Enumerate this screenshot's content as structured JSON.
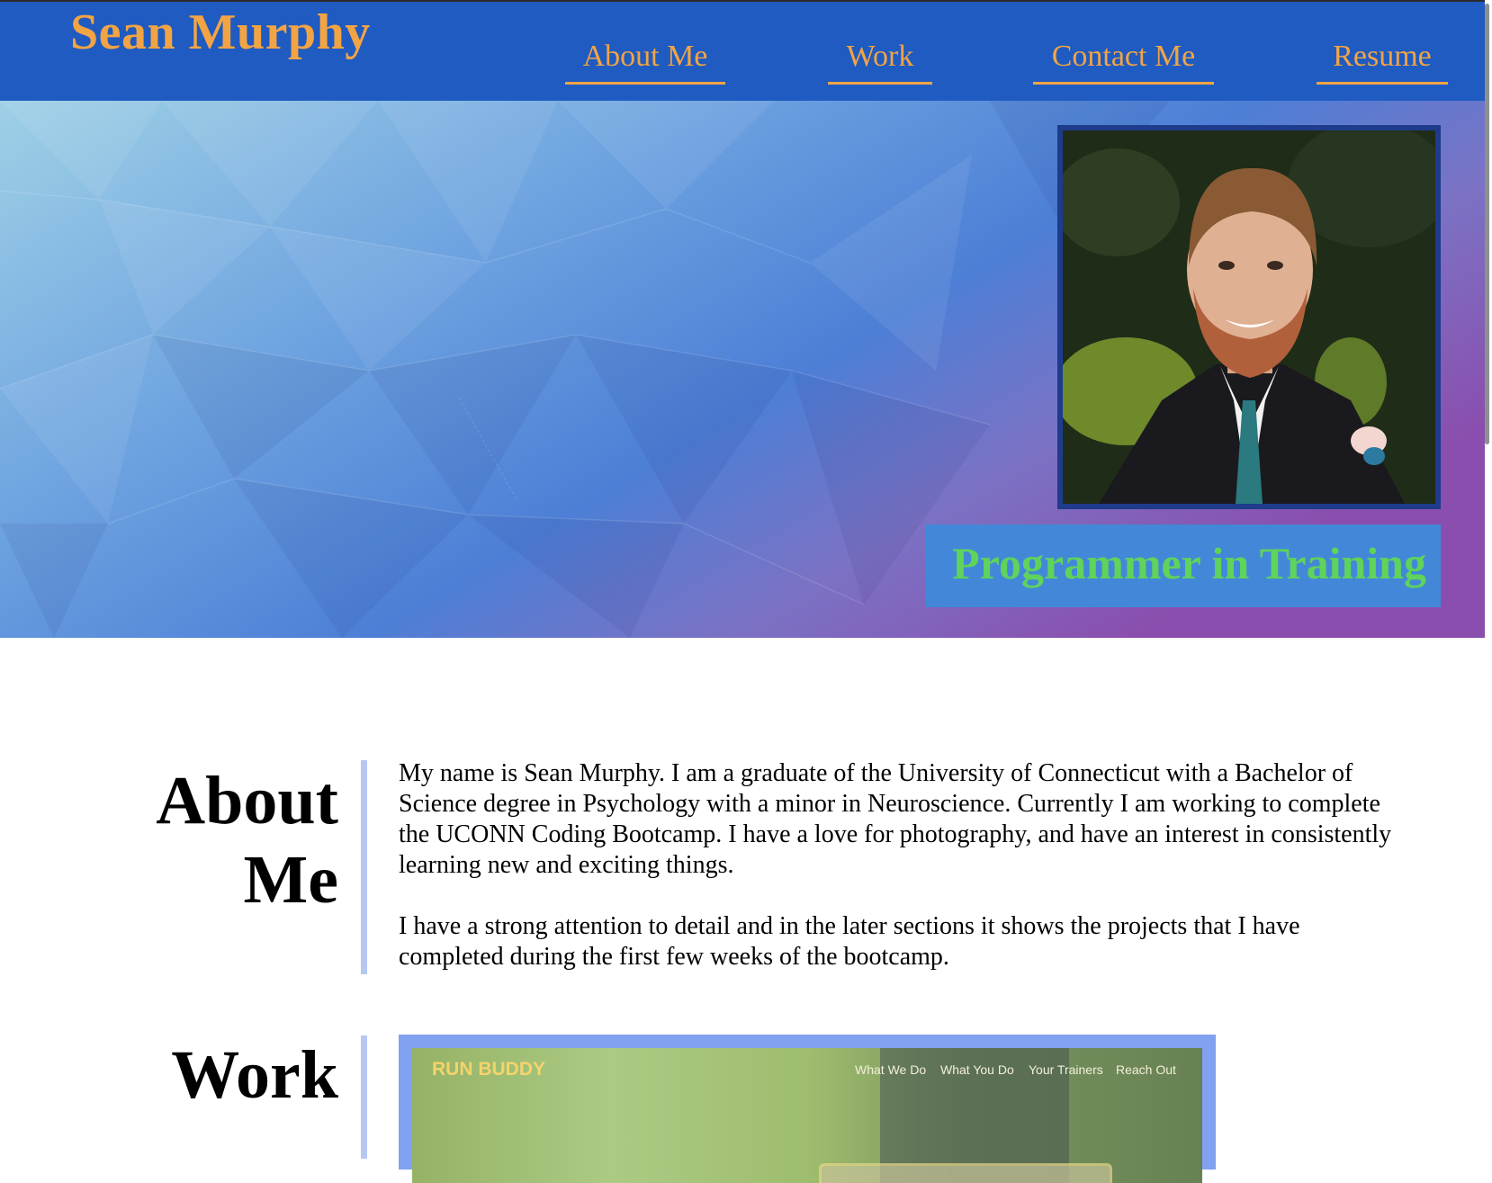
{
  "header": {
    "brand": "Sean Murphy",
    "nav": [
      "About Me",
      "Work",
      "Contact Me",
      "Resume"
    ]
  },
  "hero": {
    "tagline": "Programmer in Training"
  },
  "about": {
    "title_line1": "About",
    "title_line2": "Me",
    "paragraphs": [
      "My name is Sean Murphy. I am a graduate of the University of Connecticut with a Bachelor of Science degree in Psychology with a minor in Neuroscience. Currently I am working to complete the UCONN Coding Bootcamp. I have a love for photography, and have an interest in consistently learning new and exciting things.",
      "I have a strong attention to detail and in the later sections it shows the projects that I have completed during the first few weeks of the bootcamp."
    ]
  },
  "work": {
    "title": "Work",
    "project": {
      "brand": "RUN BUDDY",
      "links": [
        "What We Do",
        "What You Do",
        "Your Trainers",
        "Reach Out"
      ]
    }
  },
  "colors": {
    "header_bg": "#1f5bc1",
    "accent_orange": "#f2a444",
    "tagline_green": "#5fd35a",
    "tagline_bg": "#4388d8",
    "section_bar": "#b6c8f2",
    "card_border": "#82a1f0"
  }
}
